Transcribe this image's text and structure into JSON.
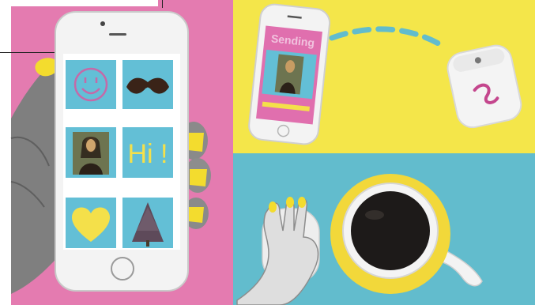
{
  "scene": {
    "colors": {
      "pink": "#e47bb0",
      "yellow": "#f4e64a",
      "blue": "#62bccd",
      "tile": "#63bfd6",
      "accent_yellow": "#f6e233",
      "phone_white": "#f3f3f3"
    }
  },
  "phone_grid": {
    "hi_tile": {
      "text": "Hi !"
    },
    "icons": [
      "smiley-icon",
      "mustache-icon",
      "mona-lisa-icon",
      "hi-text-tile",
      "heart-icon",
      "tree-icon"
    ]
  },
  "sending_phone": {
    "status_text": "Sending"
  }
}
